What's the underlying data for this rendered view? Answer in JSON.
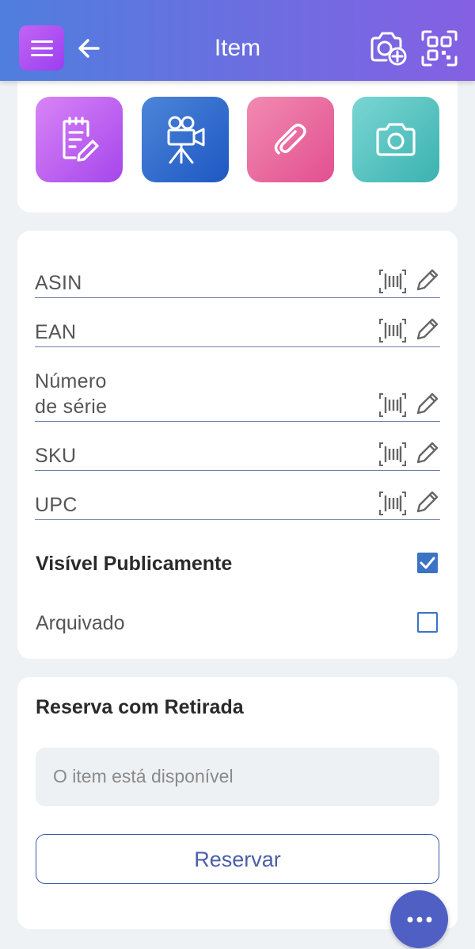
{
  "header": {
    "title": "Item"
  },
  "fields": [
    {
      "label": "ASIN"
    },
    {
      "label": "EAN"
    },
    {
      "label_line1": "Número",
      "label_line2": "de série"
    },
    {
      "label": "SKU"
    },
    {
      "label": "UPC"
    }
  ],
  "checkboxes": [
    {
      "label": "Visível Publicamente",
      "checked": true
    },
    {
      "label": "Arquivado",
      "checked": false
    }
  ],
  "reservation": {
    "title": "Reserva com Retirada",
    "status": "O item está disponível",
    "button_label": "Reservar"
  },
  "colors": {
    "accent": "#3d73c4",
    "fab": "#4f5fc4",
    "header_start": "#4f7ede",
    "header_end": "#8560e3"
  }
}
